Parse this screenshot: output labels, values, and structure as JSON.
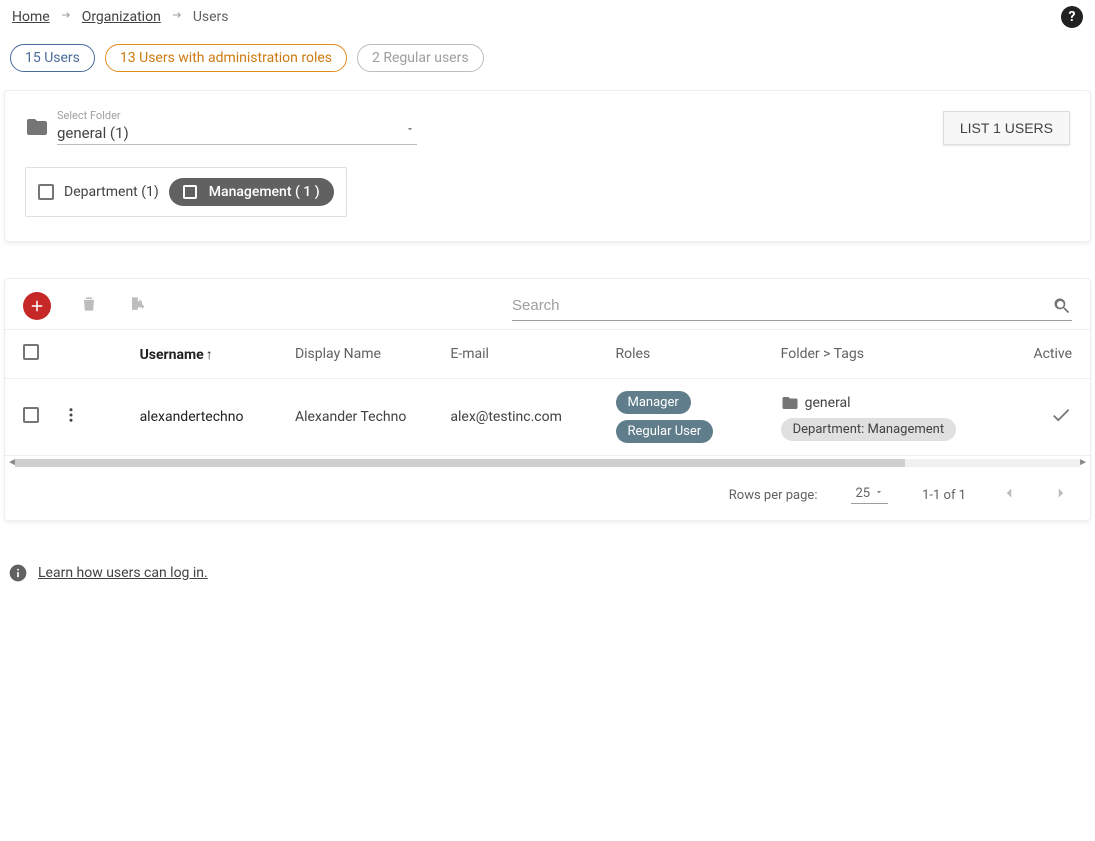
{
  "breadcrumb": {
    "home": "Home",
    "org": "Organization",
    "current": "Users"
  },
  "help_icon": "?",
  "filter_tabs": {
    "all": "15 Users",
    "admin": "13 Users with administration roles",
    "regular": "2 Regular users"
  },
  "filter_box": {
    "select_label": "Select Folder",
    "select_value": "general (1)",
    "list_button": "LIST 1 USERS",
    "tag1_label": "Department (1)",
    "tag2_label": "Management ( 1 )"
  },
  "search_placeholder": "Search",
  "table": {
    "headers": {
      "username": "Username",
      "display": "Display Name",
      "email": "E-mail",
      "roles": "Roles",
      "folder": "Folder > Tags",
      "active": "Active"
    },
    "sort_arrow": "↑",
    "row": {
      "username": "alexandertechno",
      "display": "Alexander Techno",
      "email": "alex@testinc.com",
      "role1": "Manager",
      "role2": "Regular User",
      "folder": "general",
      "tag": "Department: Management"
    }
  },
  "pager": {
    "rows_label": "Rows per page:",
    "rows_value": "25",
    "range": "1-1 of 1"
  },
  "info_link": "Learn how users can log in."
}
